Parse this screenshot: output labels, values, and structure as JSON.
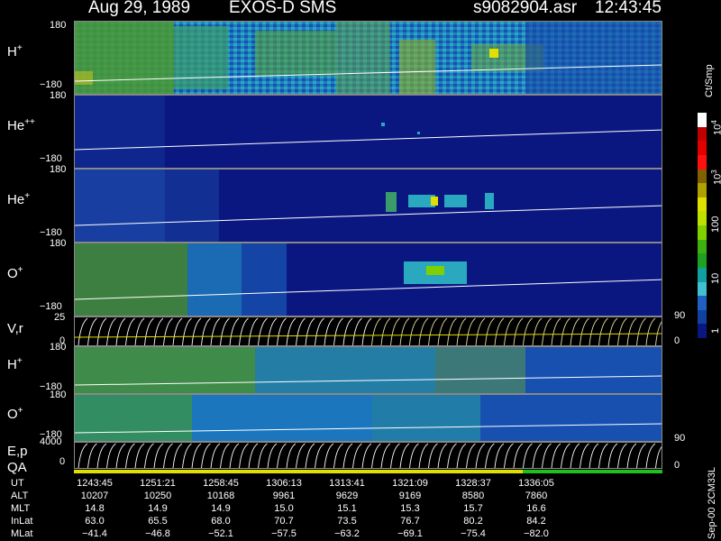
{
  "header": {
    "date": "Aug 29, 1989",
    "mission": "EXOS-D SMS",
    "filename": "s9082904.asr",
    "time": "12:43:45"
  },
  "panels": [
    {
      "label": "H",
      "sup": "+",
      "ymax": "180",
      "ymin": "−180"
    },
    {
      "label": "He",
      "sup": "++",
      "ymax": "180",
      "ymin": "−180"
    },
    {
      "label": "He",
      "sup": "+",
      "ymax": "180",
      "ymin": "−180"
    },
    {
      "label": "O",
      "sup": "+",
      "ymax": "180",
      "ymin": "−180"
    }
  ],
  "vr_panel": {
    "label": "V,r",
    "ymax": "25",
    "ymin": "0",
    "right_top": "90",
    "right_bottom": "0"
  },
  "lower_panels": [
    {
      "label": "H",
      "sup": "+",
      "ymax": "180",
      "ymin": "−180"
    },
    {
      "label": "O",
      "sup": "+",
      "ymax": "180",
      "ymin": "−180"
    }
  ],
  "ep_panel": {
    "label": "E,p",
    "ymax": "4000",
    "ymin": "0",
    "right_top": "90",
    "right_bottom": "0"
  },
  "qa_label": "QA",
  "colorbar": {
    "unit": "Ct/Smp",
    "labels": [
      "10",
      "10",
      "100",
      "10",
      "10",
      "1"
    ],
    "exponents": [
      "4",
      "3",
      "",
      "",
      "",
      ""
    ],
    "colors": [
      "#ffffff",
      "#c00000",
      "#e00000",
      "#ff1010",
      "#806000",
      "#b0a000",
      "#e0e000",
      "#c0e000",
      "#80d000",
      "#40b010",
      "#20a020",
      "#10a0a0",
      "#40c0d0",
      "#2060c0",
      "#1040a0",
      "#0a1780"
    ]
  },
  "footer_note": "Sep-00 2CM33L",
  "table": {
    "rows": [
      {
        "label": "UT",
        "values": [
          "1243:45",
          "1251:21",
          "1258:45",
          "1306:13",
          "1313:41",
          "1321:09",
          "1328:37",
          "1336:05"
        ]
      },
      {
        "label": "ALT",
        "values": [
          "10207",
          "10250",
          "10168",
          "9961",
          "9629",
          "9169",
          "8580",
          "7860"
        ]
      },
      {
        "label": "MLT",
        "values": [
          "14.8",
          "14.9",
          "14.9",
          "15.0",
          "15.1",
          "15.3",
          "15.7",
          "16.6"
        ]
      },
      {
        "label": "InLat",
        "values": [
          "63.0",
          "65.5",
          "68.0",
          "70.7",
          "73.5",
          "76.7",
          "80.2",
          "84.2"
        ]
      },
      {
        "label": "MLat",
        "values": [
          "−41.4",
          "−46.8",
          "−52.1",
          "−57.5",
          "−63.2",
          "−69.1",
          "−75.4",
          "−82.0"
        ]
      }
    ]
  },
  "chart_data": {
    "type": "heatmap",
    "title": "Aug 29, 1989 EXOS-D SMS",
    "x_ticks": [
      "1243:45",
      "1251:21",
      "1258:45",
      "1306:13",
      "1313:41",
      "1321:09",
      "1328:37",
      "1336:05"
    ],
    "species_panels": [
      "H+",
      "He++",
      "He+",
      "O+",
      "V,r",
      "H+",
      "O+",
      "E,p"
    ],
    "y_range_pitch": [
      -180,
      180
    ],
    "colorbar_scale": "log",
    "colorbar_range": [
      1,
      10000
    ]
  }
}
